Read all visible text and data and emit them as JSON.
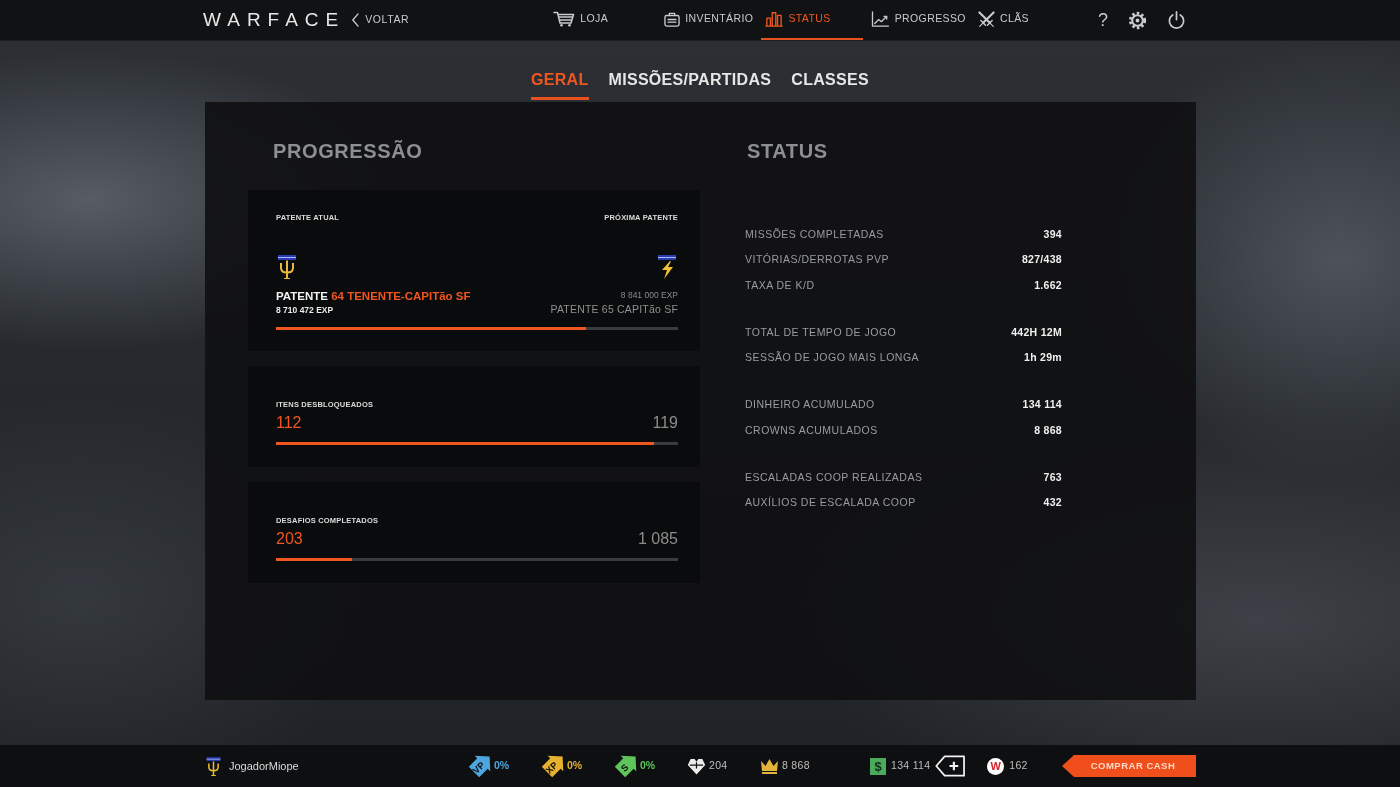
{
  "top_nav": {
    "logo": "WARFACE",
    "back": "VOLTAR",
    "items": [
      {
        "label": "LOJA",
        "selected": false
      },
      {
        "label": "INVENTÁRIO",
        "selected": false
      },
      {
        "label": "STATUS",
        "selected": true
      },
      {
        "label": "PROGRESSO",
        "selected": false
      },
      {
        "label": "CLÃS",
        "selected": false
      }
    ],
    "help": "?"
  },
  "tabs": [
    {
      "label": "GERAL",
      "selected": true
    },
    {
      "label": "MISSÕES/PARTIDAS",
      "selected": false
    },
    {
      "label": "CLASSES",
      "selected": false
    }
  ],
  "progression": {
    "title": "PROGRESSÃO",
    "rank": {
      "current_label": "PATENTE ATUAL",
      "next_label": "PRÓXIMA PATENTE",
      "current_prefix": "PATENTE",
      "current_rank": "64 TENENTE-CAPITão SF",
      "current_exp": "8 710 472 EXP",
      "next_exp": "8 841 000 EXP",
      "next_rank": "PATENTE 65 CAPITão SF",
      "level": 0.77
    },
    "counters": [
      {
        "label": "ITENS DESBLOQUEADOS",
        "value": "112",
        "total": "119",
        "level": 0.94
      },
      {
        "label": "DESAFIOS COMPLETADOS",
        "value": "203",
        "total": "1 085",
        "level": 0.19
      }
    ]
  },
  "status": {
    "title": "STATUS",
    "groups": [
      {
        "rows": [
          {
            "label": "MISSÕES COMPLETADAS",
            "value": "394"
          },
          {
            "label": "VITÓRIAS/DERROTAS PVP",
            "value": "827/438"
          },
          {
            "label": "TAXA DE K/D",
            "value": "1.662"
          }
        ]
      },
      {
        "rows": [
          {
            "label": "TOTAL DE TEMPO DE JOGO",
            "value": "442H 12M"
          },
          {
            "label": "SESSÃO DE JOGO MAIS LONGA",
            "value": "1h 29m"
          }
        ]
      },
      {
        "rows": [
          {
            "label": "DINHEIRO ACUMULADO",
            "value": "134 114"
          },
          {
            "label": "CROWNS ACUMULADOS",
            "value": "8 868"
          }
        ]
      },
      {
        "rows": [
          {
            "label": "ESCALADAS COOP REALIZADAS",
            "value": "763"
          },
          {
            "label": "AUXÍLIOS DE ESCALADA COOP",
            "value": "432"
          }
        ]
      }
    ]
  },
  "status_bar": {
    "player": "JogadorMiope",
    "boosters": [
      {
        "tag": "VP",
        "value": "0%",
        "color": "#4ea6de"
      },
      {
        "tag": "XP",
        "value": "0%",
        "color": "#e6b22e"
      },
      {
        "tag": "S",
        "value": "0%",
        "color": "#5fc45a"
      }
    ],
    "currencies": [
      {
        "kind": "heart",
        "value": "204"
      },
      {
        "kind": "crown",
        "value": "8 868"
      },
      {
        "kind": "dollar",
        "symbol": "$",
        "value": "134 114"
      },
      {
        "kind": "coin",
        "symbol": "W",
        "value": "162"
      }
    ],
    "buy_button": "COMPRAR CASH"
  }
}
